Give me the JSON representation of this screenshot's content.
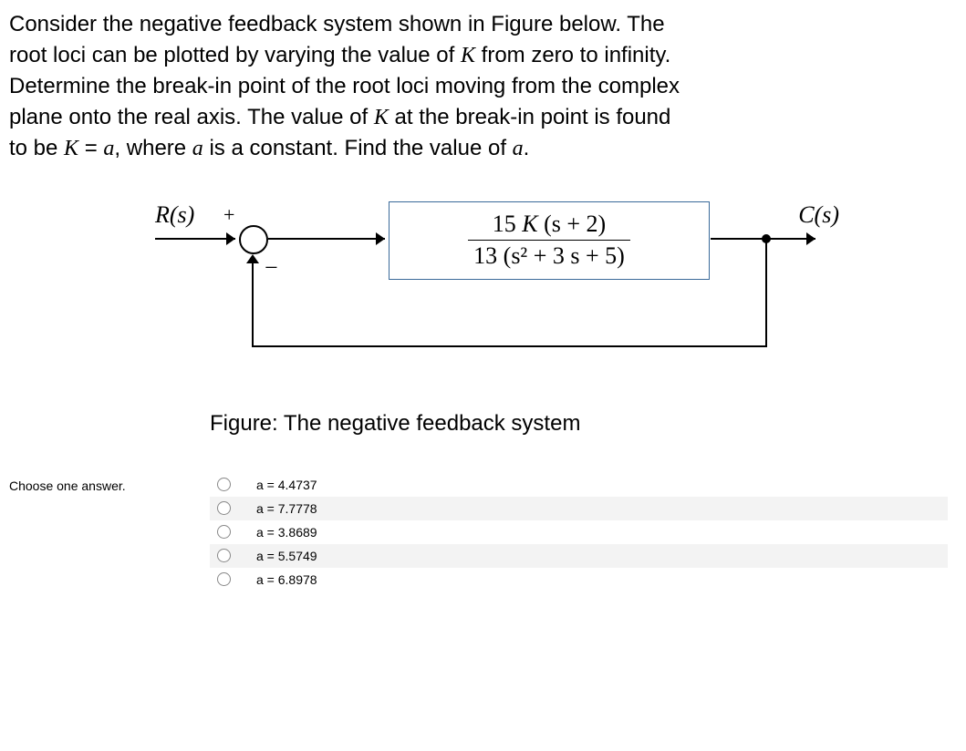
{
  "question": {
    "line1": "Consider the negative feedback system shown in Figure below. The",
    "line2": "root loci can be plotted by varying the value of ",
    "line2_var": "K",
    "line2_end": " from zero to infinity.",
    "line3": "Determine the break-in point of the root loci moving from the complex",
    "line4": "plane onto the real axis. The value of ",
    "line4_var": "K",
    "line4_mid": " at the break-in point is found",
    "line5": "to be ",
    "line5_eq_K": "K",
    "line5_eq": " = ",
    "line5_eq_a": "a",
    "line5_mid": ", where ",
    "line5_var": "a",
    "line5_end": " is a constant. Find the value of ",
    "line5_var2": "a",
    "line5_period": "."
  },
  "diagram": {
    "input": "R(s)",
    "output": "C(s)",
    "plus": "+",
    "minus": "−",
    "tf_num_prefix": "15 ",
    "tf_num_K": "K",
    "tf_num_suffix": " (s + 2)",
    "tf_den": "13 (s² + 3 s + 5)",
    "caption": "Figure: The negative feedback system"
  },
  "answers": {
    "prompt": "Choose one answer.",
    "options": [
      {
        "label": "a = 4.4737"
      },
      {
        "label": "a = 7.7778"
      },
      {
        "label": "a = 3.8689"
      },
      {
        "label": "a = 5.5749"
      },
      {
        "label": "a = 6.8978"
      }
    ]
  }
}
